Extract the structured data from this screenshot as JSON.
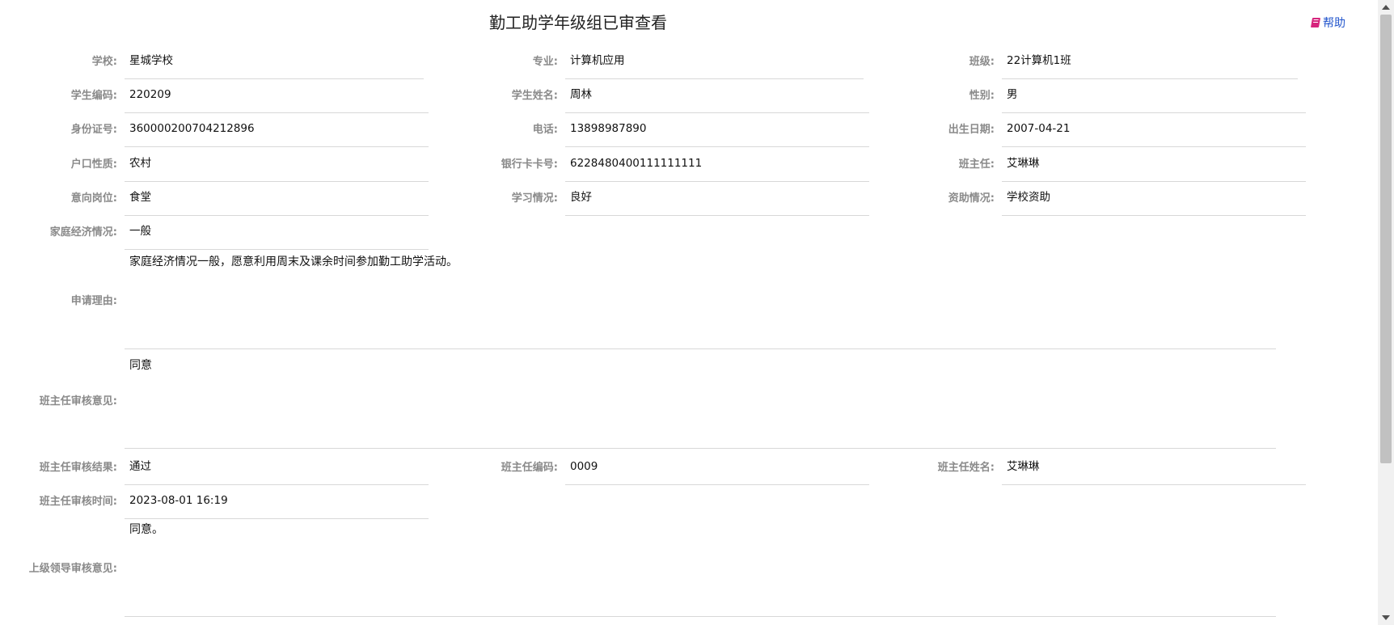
{
  "header": {
    "title": "勤工助学年级组已审查看",
    "help_label": "帮助"
  },
  "fields": {
    "school": {
      "label": "学校:",
      "value": "星城学校"
    },
    "major": {
      "label": "专业:",
      "value": "计算机应用"
    },
    "class": {
      "label": "班级:",
      "value": "22计算机1班"
    },
    "student_id": {
      "label": "学生编码:",
      "value": "220209"
    },
    "student_name": {
      "label": "学生姓名:",
      "value": "周林"
    },
    "gender": {
      "label": "性别:",
      "value": "男"
    },
    "id_card": {
      "label": "身份证号:",
      "value": "360000200704212896"
    },
    "phone": {
      "label": "电话:",
      "value": "13898987890"
    },
    "birth_date": {
      "label": "出生日期:",
      "value": "2007-04-21"
    },
    "household": {
      "label": "户口性质:",
      "value": "农村"
    },
    "bank_card": {
      "label": "银行卡卡号:",
      "value": "6228480400111111111"
    },
    "head_teacher": {
      "label": "班主任:",
      "value": "艾琳琳"
    },
    "intended_post": {
      "label": "意向岗位:",
      "value": "食堂"
    },
    "study_status": {
      "label": "学习情况:",
      "value": "良好"
    },
    "aid_status": {
      "label": "资助情况:",
      "value": "学校资助"
    },
    "family_economy": {
      "label": "家庭经济情况:",
      "value": "一般"
    },
    "apply_reason": {
      "label": "申请理由:",
      "value": "家庭经济情况一般，愿意利用周末及课余时间参加勤工助学活动。"
    },
    "teacher_opinion": {
      "label": "班主任审核意见:",
      "value": "同意"
    },
    "teacher_result": {
      "label": "班主任审核结果:",
      "value": "通过"
    },
    "teacher_code": {
      "label": "班主任编码:",
      "value": "0009"
    },
    "teacher_name": {
      "label": "班主任姓名:",
      "value": "艾琳琳"
    },
    "teacher_time": {
      "label": "班主任审核时间:",
      "value": "2023-08-01 16:19"
    },
    "leader_opinion": {
      "label": "上级领导审核意见:",
      "value": "同意。"
    }
  }
}
